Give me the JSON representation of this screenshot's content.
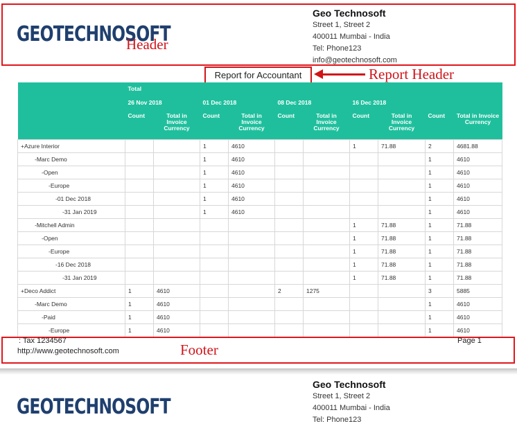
{
  "page1": {
    "logo_text": "GEOTECHNOSOFT",
    "company": {
      "name": "Geo Technosoft",
      "lines": [
        "Street 1, Street 2",
        "400011 Mumbai - India",
        "Tel: Phone123",
        "info@geotechnosoft.com"
      ]
    },
    "annotations": {
      "header": "Header",
      "report_header": "Report Header",
      "footer": "Footer"
    },
    "report_title": "Report for Accountant"
  },
  "table": {
    "total_label": "Total",
    "dates": [
      "26 Nov 2018",
      "01 Dec 2018",
      "08 Dec 2018",
      "16 Dec 2018"
    ],
    "count_label": "Count",
    "total_currency_label": "Total in Invoice Currency",
    "rows": [
      {
        "label": "+Azure Interior",
        "level": 0,
        "v": [
          "",
          "",
          "1",
          "4610",
          "",
          "",
          "1",
          "71.88",
          "2",
          "4681.88"
        ]
      },
      {
        "label": "-Marc Demo",
        "level": 1,
        "v": [
          "",
          "",
          "1",
          "4610",
          "",
          "",
          "",
          "",
          "1",
          "4610"
        ]
      },
      {
        "label": "-Open",
        "level": 2,
        "v": [
          "",
          "",
          "1",
          "4610",
          "",
          "",
          "",
          "",
          "1",
          "4610"
        ]
      },
      {
        "label": "-Europe",
        "level": 3,
        "v": [
          "",
          "",
          "1",
          "4610",
          "",
          "",
          "",
          "",
          "1",
          "4610"
        ]
      },
      {
        "label": "-01 Dec 2018",
        "level": 4,
        "v": [
          "",
          "",
          "1",
          "4610",
          "",
          "",
          "",
          "",
          "1",
          "4610"
        ]
      },
      {
        "label": "-31 Jan 2019",
        "level": 5,
        "v": [
          "",
          "",
          "1",
          "4610",
          "",
          "",
          "",
          "",
          "1",
          "4610"
        ]
      },
      {
        "label": "-Mitchell Admin",
        "level": 1,
        "v": [
          "",
          "",
          "",
          "",
          "",
          "",
          "1",
          "71.88",
          "1",
          "71.88"
        ]
      },
      {
        "label": "-Open",
        "level": 2,
        "v": [
          "",
          "",
          "",
          "",
          "",
          "",
          "1",
          "71.88",
          "1",
          "71.88"
        ]
      },
      {
        "label": "-Europe",
        "level": 3,
        "v": [
          "",
          "",
          "",
          "",
          "",
          "",
          "1",
          "71.88",
          "1",
          "71.88"
        ]
      },
      {
        "label": "-16 Dec 2018",
        "level": 4,
        "v": [
          "",
          "",
          "",
          "",
          "",
          "",
          "1",
          "71.88",
          "1",
          "71.88"
        ]
      },
      {
        "label": "-31 Jan 2019",
        "level": 5,
        "v": [
          "",
          "",
          "",
          "",
          "",
          "",
          "1",
          "71.88",
          "1",
          "71.88"
        ]
      },
      {
        "label": "+Deco Addict",
        "level": 0,
        "v": [
          "1",
          "4610",
          "",
          "",
          "2",
          "1275",
          "",
          "",
          "3",
          "5885"
        ]
      },
      {
        "label": "-Marc Demo",
        "level": 1,
        "v": [
          "1",
          "4610",
          "",
          "",
          "",
          "",
          "",
          "",
          "1",
          "4610"
        ]
      },
      {
        "label": "-Paid",
        "level": 2,
        "v": [
          "1",
          "4610",
          "",
          "",
          "",
          "",
          "",
          "",
          "1",
          "4610"
        ]
      },
      {
        "label": "-Europe",
        "level": 3,
        "v": [
          "1",
          "4610",
          "",
          "",
          "",
          "",
          "",
          "",
          "1",
          "4610"
        ]
      }
    ]
  },
  "footer": {
    "tax": ": Tax 1234567",
    "website": "http://www.geotechnosoft.com",
    "page": "Page 1"
  },
  "page2": {
    "logo_text": "GEOTECHNOSOFT",
    "company": {
      "name": "Geo Technosoft",
      "lines": [
        "Street 1, Street 2",
        "400011 Mumbai - India",
        "Tel: Phone123"
      ]
    }
  }
}
